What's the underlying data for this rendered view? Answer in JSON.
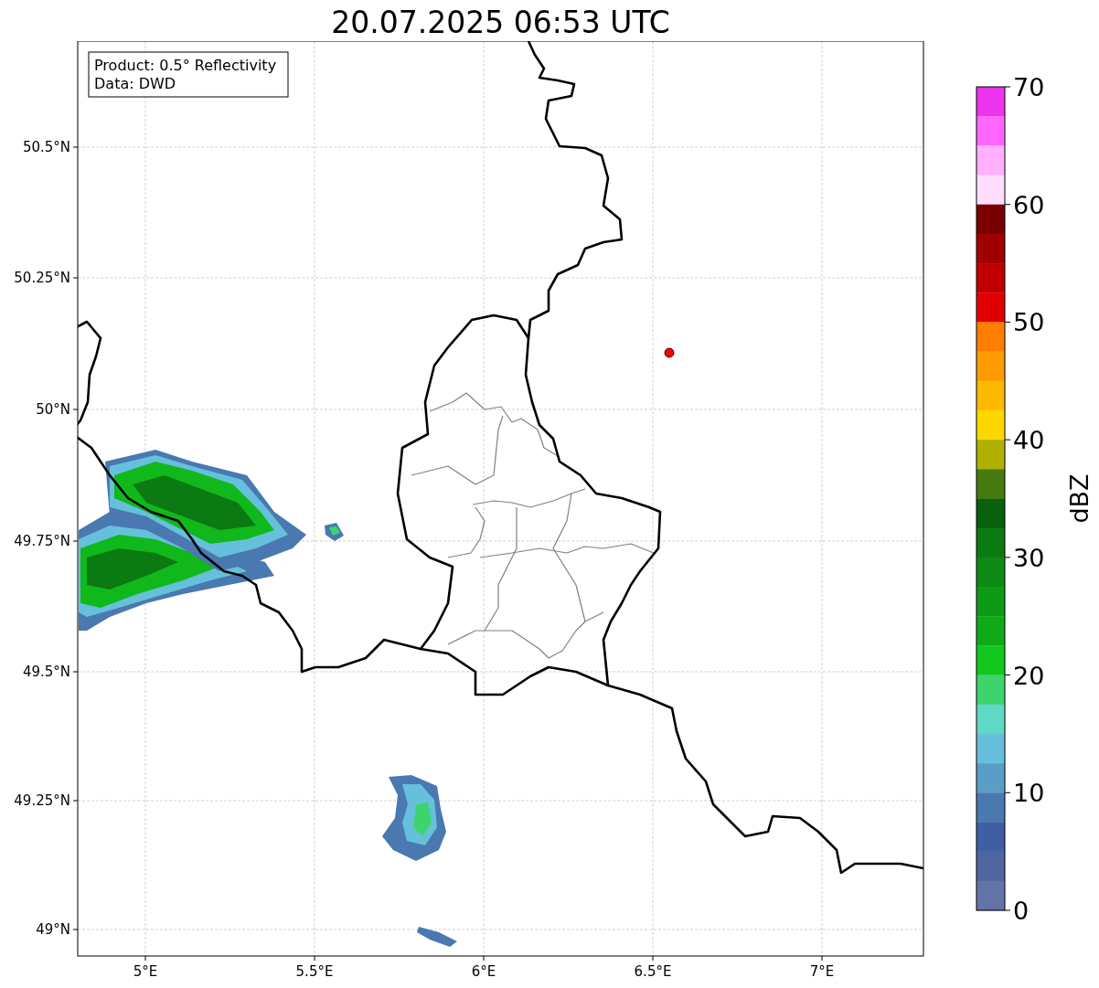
{
  "title": "20.07.2025 06:53 UTC",
  "legend": [
    "Product: 0.5° Reflectivity",
    "Data: DWD"
  ],
  "lat_labels": [
    "50.5°N",
    "50.25°N",
    "50°N",
    "49.75°N",
    "49.5°N",
    "49.25°N",
    "49°N"
  ],
  "lon_labels": [
    "5°E",
    "5.5°E",
    "6°E",
    "6.5°E",
    "7°E"
  ],
  "colorbar": {
    "label": "dBZ",
    "ticks": [
      "70",
      "60",
      "50",
      "40",
      "30",
      "20",
      "10",
      "0"
    ],
    "bands": [
      {
        "color": "#ee33ee"
      },
      {
        "color": "#ff66ff"
      },
      {
        "color": "#ffb0ff"
      },
      {
        "color": "#ffddff"
      },
      {
        "color": "#7a0000"
      },
      {
        "color": "#a00000"
      },
      {
        "color": "#c00000"
      },
      {
        "color": "#e00000"
      },
      {
        "color": "#ff7d00"
      },
      {
        "color": "#ff9a00"
      },
      {
        "color": "#ffb800"
      },
      {
        "color": "#ffd700"
      },
      {
        "color": "#b0b000"
      },
      {
        "color": "#467a0e"
      },
      {
        "color": "#08600c"
      },
      {
        "color": "#0b7a12"
      },
      {
        "color": "#0e8a14"
      },
      {
        "color": "#0f9a16"
      },
      {
        "color": "#10aa18"
      },
      {
        "color": "#12c81c"
      },
      {
        "color": "#3dd46e"
      },
      {
        "color": "#5fd9c5"
      },
      {
        "color": "#66c0dc"
      },
      {
        "color": "#5a9ec8"
      },
      {
        "color": "#4a78b0"
      },
      {
        "color": "#405ea2"
      },
      {
        "color": "#5066a0"
      },
      {
        "color": "#6473a6"
      }
    ]
  }
}
